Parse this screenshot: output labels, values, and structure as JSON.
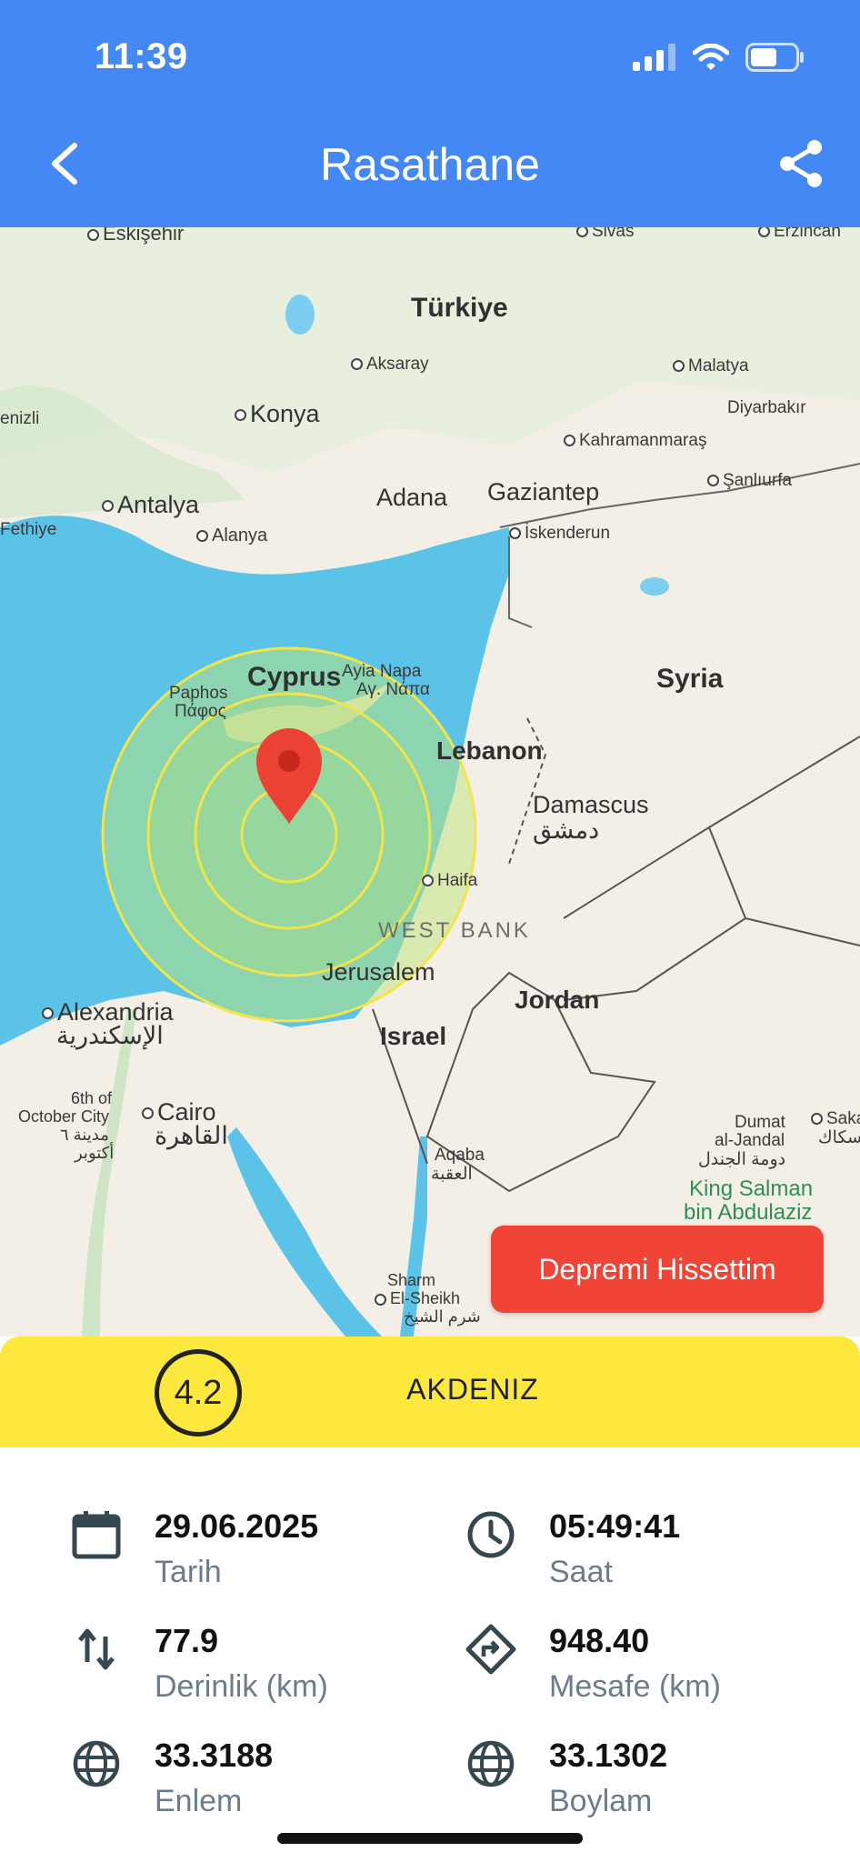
{
  "status": {
    "time": "11:39"
  },
  "header": {
    "title": "Rasathane"
  },
  "map": {
    "labels": {
      "turkiye": "Türkiye",
      "eskisehir": "Eskişehir",
      "sivas": "Sivas",
      "erzincan": "Erzincan",
      "aksaray": "Aksaray",
      "malatya": "Malatya",
      "konya": "Konya",
      "denizli": "enizli",
      "diyarbakir": "Diyarbakır",
      "kahramanmaras": "Kahramanmaraş",
      "antalya": "Antalya",
      "adana": "Adana",
      "gaziantep": "Gaziantep",
      "sanliurfa": "Şanlıurfa",
      "fethiye": "Fethiye",
      "alanya": "Alanya",
      "iskenderun": "İskenderun",
      "cyprus": "Cyprus",
      "ayia_napa": "Ayia Napa",
      "ayia_napa_gr": "Αγ. Νάπα",
      "paphos": "Paphos",
      "paphos_gr": "Πάφος",
      "syria": "Syria",
      "lebanon": "Lebanon",
      "damascus": "Damascus",
      "damascus_ar": "دمشق",
      "haifa": "Haifa",
      "west_bank": "WEST BANK",
      "jerusalem": "Jerusalem",
      "jordan": "Jordan",
      "alexandria": "Alexandria",
      "alexandria_ar": "الإسكندرية",
      "israel": "Israel",
      "sixth_october": "6th of",
      "october_city": "October City",
      "sixth_october_ar": "مدينة ٦",
      "october_ar": "أكتوبر",
      "cairo": "Cairo",
      "cairo_ar": "القاهرة",
      "dumat": "Dumat",
      "al_jandal": "al-Jandal",
      "dumat_ar": "دومة الجندل",
      "saka": "Saka",
      "saka_ar": "سكاك",
      "aqaba": "Aqaba",
      "aqaba_ar": "العقبة",
      "king_salman": "King Salman",
      "bin_abdulaziz": "bin Abdulaziz",
      "sharm": "Sharm",
      "el_sheikh": "El-Sheikh",
      "sharm_ar": "شرم الشيخ"
    },
    "felt_button": "Depremi Hissettim",
    "colors": {
      "sea": "#5cc3e8",
      "land": "#f3efe6",
      "ring": "#f2e547",
      "pin": "#ea4335"
    }
  },
  "quake": {
    "magnitude": "4.2",
    "region": "AKDENIZ",
    "date": {
      "value": "29.06.2025",
      "label": "Tarih"
    },
    "time": {
      "value": "05:49:41",
      "label": "Saat"
    },
    "depth": {
      "value": "77.9",
      "label": "Derinlik (km)"
    },
    "distance": {
      "value": "948.40",
      "label": "Mesafe (km)"
    },
    "latitude": {
      "value": "33.3188",
      "label": "Enlem"
    },
    "longitude": {
      "value": "33.1302",
      "label": "Boylam"
    }
  },
  "icons": [
    "back-icon",
    "share-icon",
    "calendar-icon",
    "clock-icon",
    "depth-arrows-icon",
    "directions-icon",
    "globe-icon",
    "map-pin-icon"
  ]
}
